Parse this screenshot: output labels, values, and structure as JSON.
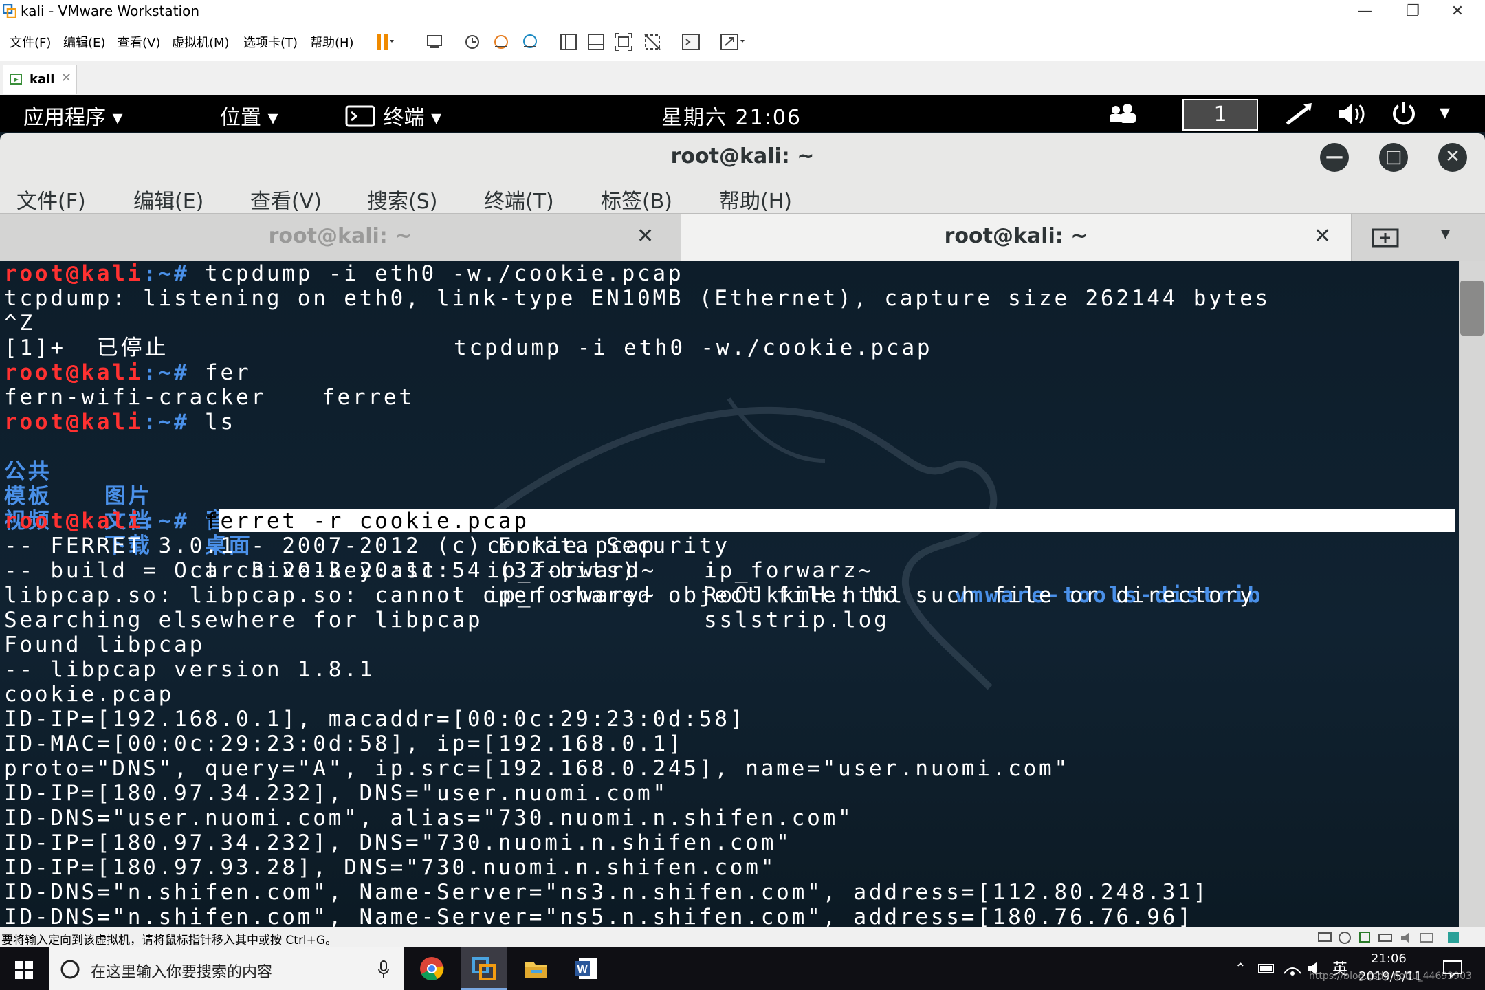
{
  "vmware": {
    "title": "kali - VMware Workstation",
    "menu": [
      "文件(F)",
      "编辑(E)",
      "查看(V)",
      "虚拟机(M)",
      "选项卡(T)",
      "帮助(H)"
    ],
    "tab_label": "kali",
    "status_text": "要将输入定向到该虚拟机，请将鼠标指针移入其中或按 Ctrl+G。"
  },
  "kali_panel": {
    "apps": "应用程序",
    "places": "位置",
    "terminal": "终端",
    "clock": "星期六 21:06",
    "workspace": "1"
  },
  "terminal": {
    "title": "root@kali: ~",
    "menu": [
      "文件(F)",
      "编辑(E)",
      "查看(V)",
      "搜索(S)",
      "终端(T)",
      "标签(B)",
      "帮助(H)"
    ],
    "tabs": [
      "root@kali: ~",
      "root@kali: ~"
    ],
    "prompt_user": "root@kali",
    "prompt_suffix": ":~#",
    "lines": {
      "l1_cmd": " tcpdump -i eth0 -w./cookie.pcap",
      "l2": "tcpdump: listening on eth0, link-type EN10MB (Ethernet), capture size 262144 bytes",
      "l3": "^Z",
      "l4a": "[1]+  已停止",
      "l4b": "tcpdump -i eth0 -w./cookie.pcap",
      "l5_cmd": " fer",
      "l6a": "fern-wifi-cracker",
      "l6b": "ferret",
      "l7_cmd": " ls",
      "ls_dirs_row1": [
        "公共",
        "图片",
        "音乐"
      ],
      "ls_dirs_row2": [
        "模板",
        "文档",
        "桌面"
      ],
      "ls_dirs_row3": [
        "视频",
        "下载"
      ],
      "ls_files_row3_col3": "archive-key.asc",
      "ls_col4": [
        "cookie.pcap",
        "ip_forward~",
        "ip_forwary~"
      ],
      "ls_col5": [
        "ip_forwarz~",
        "RoOJkkmH.html",
        "sslstrip.log"
      ],
      "ls_col6": "vmware-tools-distrib",
      "l11_cmd": "ferret -r cookie.pcap",
      "out": [
        "-- FERRET 3.0.1 - 2007-2012 (c) Errata Security",
        "-- build = Oct  3 2013 20:11:54 (32-bits)",
        "libpcap.so: libpcap.so: cannot open shared object file: No such file or directory",
        "Searching elsewhere for libpcap",
        "Found libpcap",
        "-- libpcap version 1.8.1",
        "cookie.pcap",
        "ID-IP=[192.168.0.1], macaddr=[00:0c:29:23:0d:58]",
        "ID-MAC=[00:0c:29:23:0d:58], ip=[192.168.0.1]",
        "proto=\"DNS\", query=\"A\", ip.src=[192.168.0.245], name=\"user.nuomi.com\"",
        "ID-IP=[180.97.34.232], DNS=\"user.nuomi.com\"",
        "ID-DNS=\"user.nuomi.com\", alias=\"730.nuomi.n.shifen.com\"",
        "ID-IP=[180.97.34.232], DNS=\"730.nuomi.n.shifen.com\"",
        "ID-IP=[180.97.93.28], DNS=\"730.nuomi.n.shifen.com\"",
        "ID-DNS=\"n.shifen.com\", Name-Server=\"ns3.n.shifen.com\", address=[112.80.248.31]",
        "ID-DNS=\"n.shifen.com\", Name-Server=\"ns5.n.shifen.com\", address=[180.76.76.96]"
      ]
    }
  },
  "taskbar": {
    "search_placeholder": "在这里输入你要搜索的内容",
    "ime": "英",
    "time": "21:06",
    "date": "2019/5/11",
    "watermark": "https://blog.csdn.net/u_44693903"
  },
  "colors": {
    "prompt_red": "#ff3131",
    "dir_blue": "#4a90e8",
    "terminal_bg": "#0d1d2a"
  }
}
